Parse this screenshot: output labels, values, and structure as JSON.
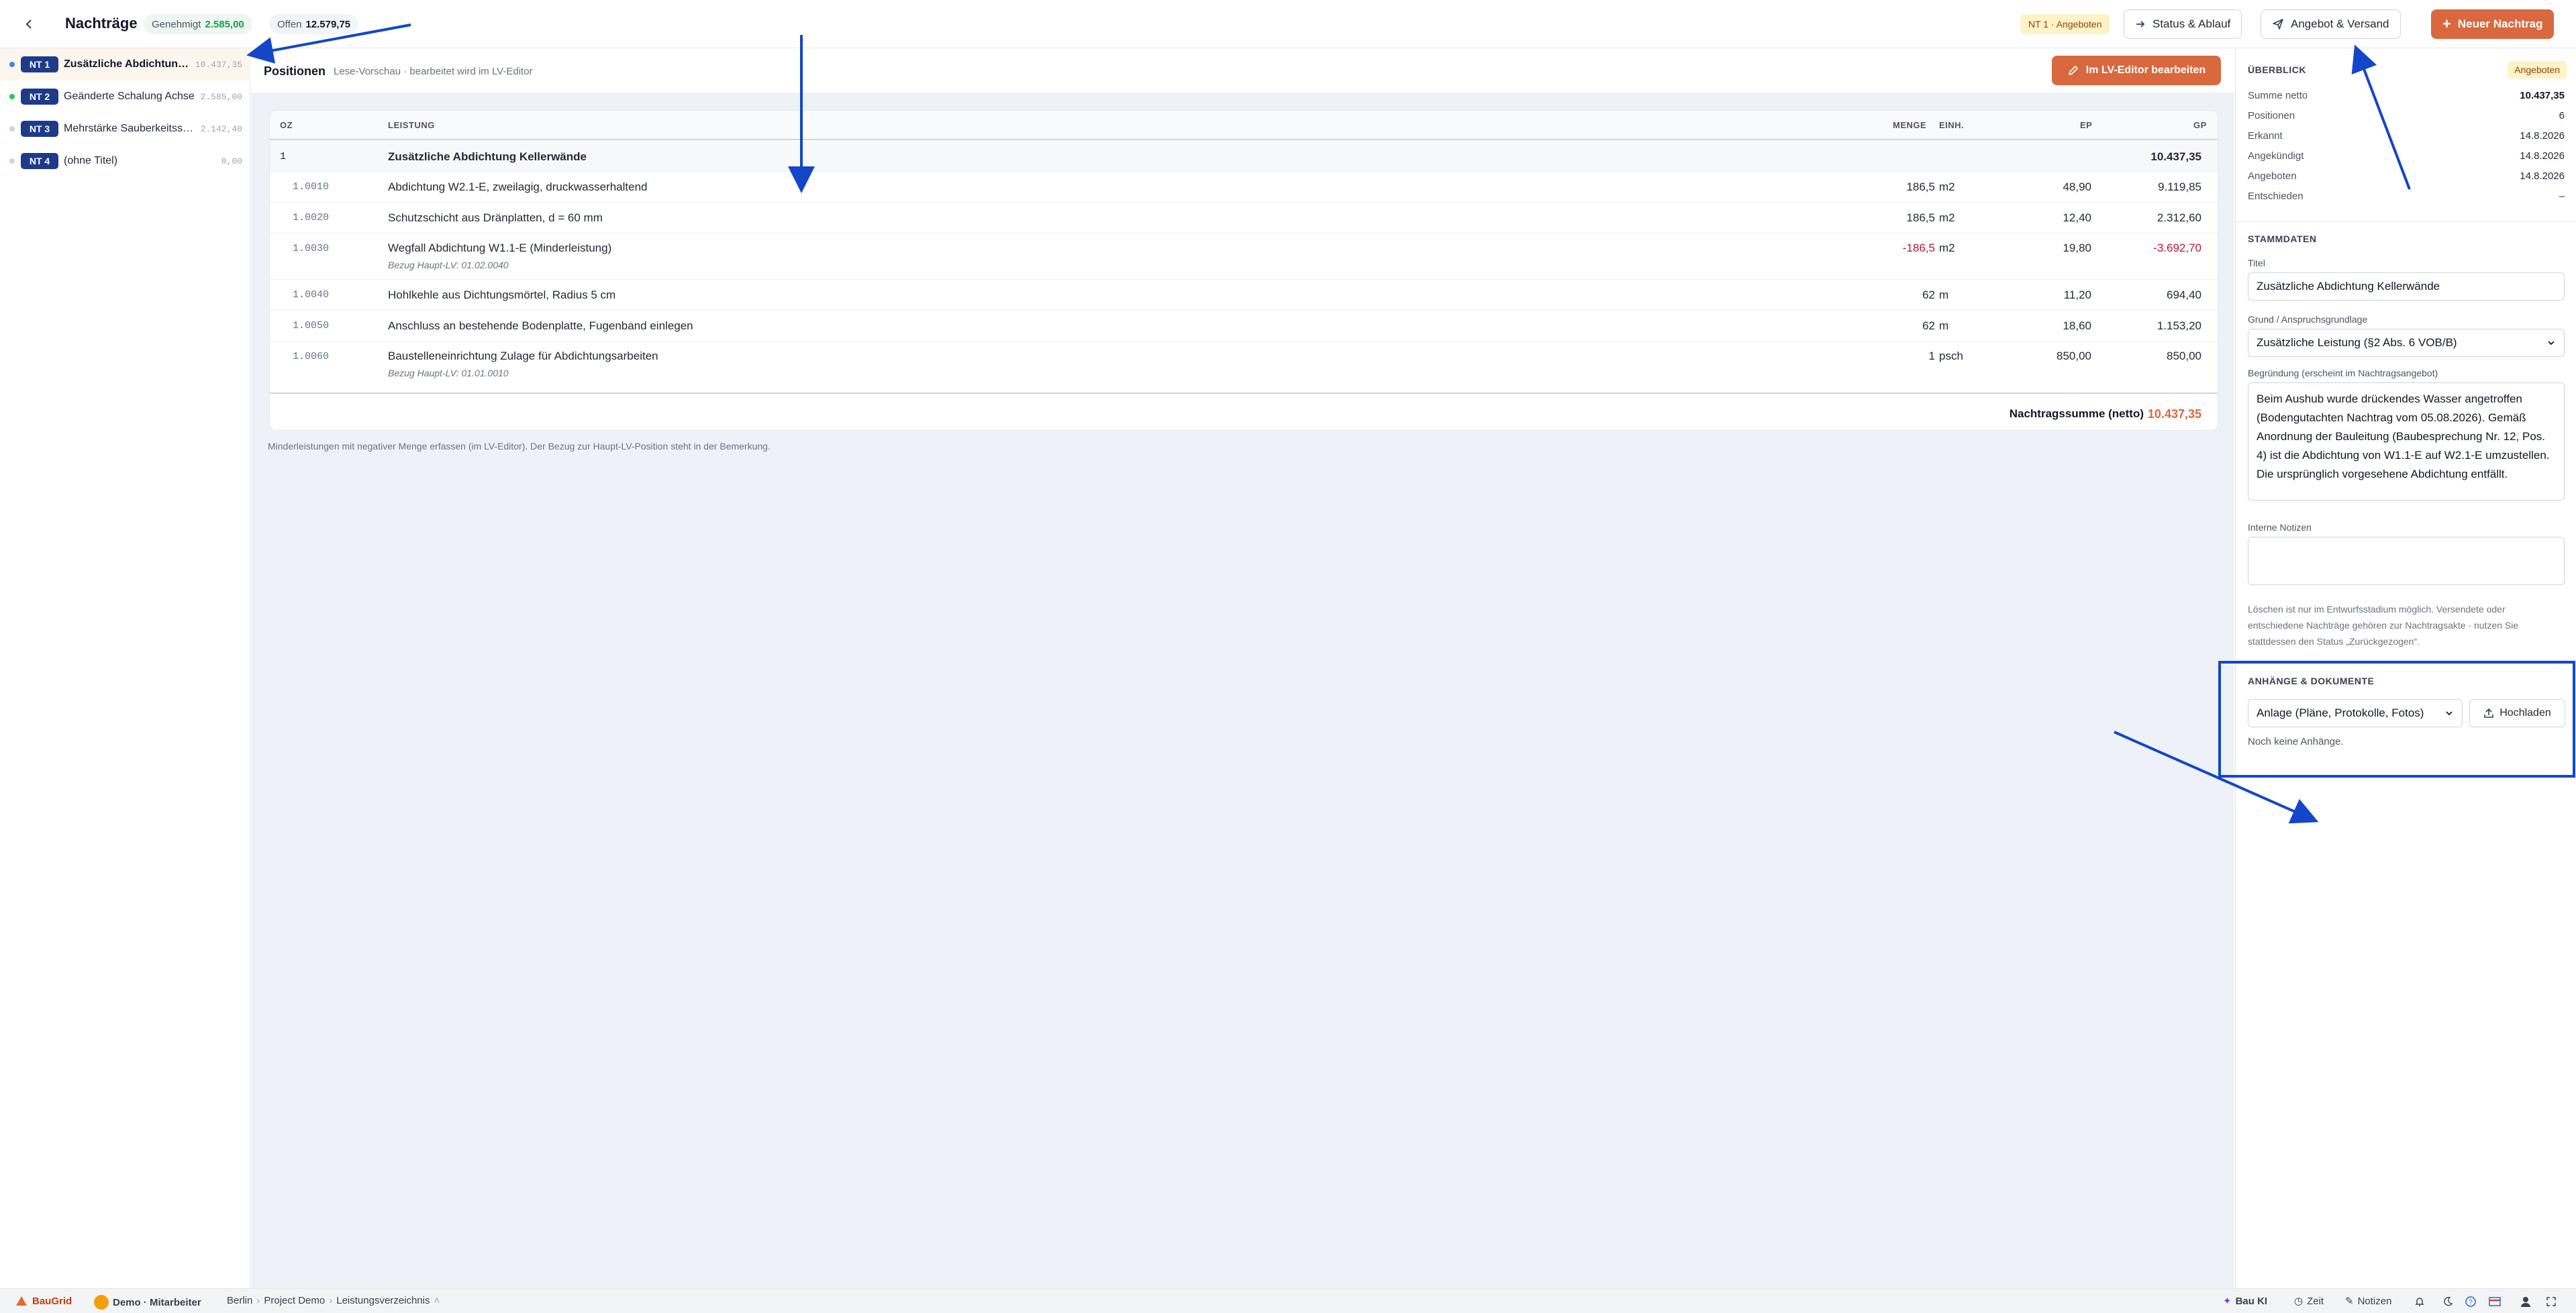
{
  "header": {
    "title": "Nachträge",
    "approved_label": "Genehmigt",
    "approved_value": "2.585,00",
    "open_label": "Offen",
    "open_value": "12.579,75",
    "status_chip": "NT 1 · Angeboten",
    "btn_status": "Status & Ablauf",
    "btn_versand": "Angebot & Versand",
    "btn_new": "Neuer Nachtrag"
  },
  "sidebar": {
    "items": [
      {
        "badge": "NT 1",
        "title": "Zusätzliche Abdichtung Kellerwände",
        "amount": "10.437,35",
        "dot_color": "#3b82f6"
      },
      {
        "badge": "NT 2",
        "title": "Geänderte Schalung Achse",
        "amount": "2.585,00",
        "dot_color": "#22c55e"
      },
      {
        "badge": "NT 3",
        "title": "Mehrstärke Sauberkeitsschicht",
        "amount": "2.142,40",
        "dot_color": "#cbd5e1"
      },
      {
        "badge": "NT 4",
        "title": "(ohne Titel)",
        "amount": "0,00",
        "dot_color": "#cbd5e1"
      }
    ]
  },
  "positions": {
    "title": "Positionen",
    "subtitle": "Lese-Vorschau · bearbeitet wird im LV-Editor",
    "editor_button": "Im LV-Editor bearbeiten",
    "columns": {
      "oz": "OZ",
      "leistung": "LEISTUNG",
      "menge": "MENGE",
      "einh": "EINH.",
      "ep": "EP",
      "gp": "GP"
    },
    "group": {
      "oz": "1",
      "title": "Zusätzliche Abdichtung Kellerwände",
      "gp": "10.437,35"
    },
    "rows": [
      {
        "oz": "1.0010",
        "text": "Abdichtung W2.1-E, zweilagig, druckwasserhaltend",
        "note": "",
        "menge": "186,5",
        "einh": "m2",
        "ep": "48,90",
        "gp": "9.119,85"
      },
      {
        "oz": "1.0020",
        "text": "Schutzschicht aus Dränplatten, d = 60 mm",
        "note": "",
        "menge": "186,5",
        "einh": "m2",
        "ep": "12,40",
        "gp": "2.312,60"
      },
      {
        "oz": "1.0030",
        "text": "Wegfall Abdichtung W1.1-E (Minderleistung)",
        "note": "Bezug Haupt-LV: 01.02.0040",
        "menge": "-186,5",
        "einh": "m2",
        "ep": "19,80",
        "gp": "-3.692,70"
      },
      {
        "oz": "1.0040",
        "text": "Hohlkehle aus Dichtungsmörtel, Radius 5 cm",
        "note": "",
        "menge": "62",
        "einh": "m",
        "ep": "11,20",
        "gp": "694,40"
      },
      {
        "oz": "1.0050",
        "text": "Anschluss an bestehende Bodenplatte, Fugenband einlegen",
        "note": "",
        "menge": "62",
        "einh": "m",
        "ep": "18,60",
        "gp": "1.153,20"
      },
      {
        "oz": "1.0060",
        "text": "Baustelleneinrichtung Zulage für Abdichtungsarbeiten",
        "note": "Bezug Haupt-LV: 01.01.0010",
        "menge": "1",
        "einh": "psch",
        "ep": "850,00",
        "gp": "850,00"
      }
    ],
    "sum_label": "Nachtragssumme (netto)",
    "sum_value": "10.437,35",
    "footnote": "Minderleistungen mit negativer Menge erfassen (im LV-Editor). Der Bezug zur Haupt-LV-Position steht in der Bemerkung."
  },
  "overview": {
    "title": "ÜBERBLICK",
    "chip": "Angeboten",
    "items": [
      {
        "k": "Summe netto",
        "v": "10.437,35"
      },
      {
        "k": "Positionen",
        "v": "6"
      },
      {
        "k": "Erkannt",
        "v": "14.8.2026"
      },
      {
        "k": "Angekündigt",
        "v": "14.8.2026"
      },
      {
        "k": "Angeboten",
        "v": "14.8.2026"
      },
      {
        "k": "Entschieden",
        "v": "–"
      }
    ]
  },
  "stammdaten": {
    "title": "STAMMDATEN",
    "titel_label": "Titel",
    "titel_value": "Zusätzliche Abdichtung Kellerwände",
    "grund_label": "Grund / Anspruchsgrundlage",
    "grund_value": "Zusätzliche Leistung (§2 Abs. 6 VOB/B)",
    "begr_label": "Begründung (erscheint im Nachtragsangebot)",
    "begr_value": "Beim Aushub wurde drückendes Wasser angetroffen (Bodengutachten Nachtrag vom 05.08.2026). Gemäß Anordnung der Bauleitung (Baubesprechung Nr. 12, Pos. 4) ist die Abdichtung von W1.1-E auf W2.1-E umzustellen. Die ursprünglich vorgesehene Abdichtung entfällt.",
    "notes_label": "Interne Notizen",
    "notes_value": "",
    "hint": "Löschen ist nur im Entwurfsstadium möglich. Versendete oder entschiedene Nachträge gehören zur Nachtragsakte · nutzen Sie stattdessen den Status „Zurückgezogen“."
  },
  "attachments": {
    "title": "ANHÄNGE & DOKUMENTE",
    "select_value": "Anlage (Pläne, Protokolle, Fotos)",
    "upload_label": "Hochladen",
    "empty": "Noch keine Anhänge."
  },
  "bottombar": {
    "brand": "BauGrid",
    "user": "Demo · Mitarbeiter",
    "crumbs": [
      "Berlin",
      "Project Demo",
      "Leistungsverzeichnis"
    ],
    "ai": "Bau KI",
    "time": "Zeit",
    "notes": "Notizen"
  },
  "colors": {
    "accent": "#d9683f",
    "badge_navy": "#1e3a8a",
    "annotation_blue": "#1346c9",
    "negative": "#be123c",
    "approved_green": "#16a34a"
  }
}
